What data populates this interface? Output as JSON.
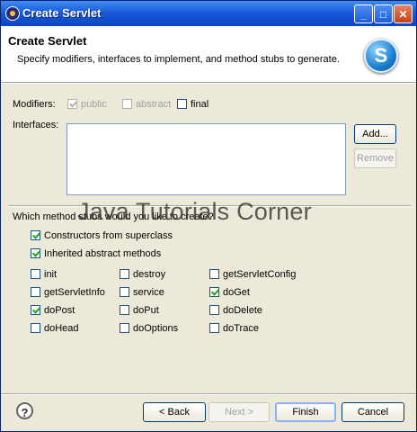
{
  "window": {
    "title": "Create Servlet",
    "controls": {
      "minimize": "_",
      "maximize": "□",
      "close": "✕"
    }
  },
  "header": {
    "title": "Create Servlet",
    "description": "Specify modifiers, interfaces to implement, and method stubs to generate.",
    "logo_letter": "S"
  },
  "modifiers": {
    "label": "Modifiers:",
    "options": [
      {
        "label": "public",
        "checked": true,
        "enabled": false
      },
      {
        "label": "abstract",
        "checked": false,
        "enabled": false
      },
      {
        "label": "final",
        "checked": false,
        "enabled": true
      }
    ]
  },
  "interfaces": {
    "label": "Interfaces:",
    "add_label": "Add...",
    "remove_label": "Remove"
  },
  "methods": {
    "prompt": "Which method stubs would you like to create?",
    "constructors_label": "Constructors from superclass",
    "constructors_checked": true,
    "inherited_label": "Inherited abstract methods",
    "inherited_checked": true,
    "items": [
      {
        "label": "init",
        "checked": false
      },
      {
        "label": "destroy",
        "checked": false
      },
      {
        "label": "getServletConfig",
        "checked": false
      },
      {
        "label": "getServletInfo",
        "checked": false
      },
      {
        "label": "service",
        "checked": false
      },
      {
        "label": "doGet",
        "checked": true
      },
      {
        "label": "doPost",
        "checked": true
      },
      {
        "label": "doPut",
        "checked": false
      },
      {
        "label": "doDelete",
        "checked": false
      },
      {
        "label": "doHead",
        "checked": false
      },
      {
        "label": "doOptions",
        "checked": false
      },
      {
        "label": "doTrace",
        "checked": false
      }
    ]
  },
  "watermark": "Java Tutorials Corner",
  "footer": {
    "help_icon": "?",
    "back_label": "< Back",
    "next_label": "Next >",
    "finish_label": "Finish",
    "cancel_label": "Cancel"
  }
}
